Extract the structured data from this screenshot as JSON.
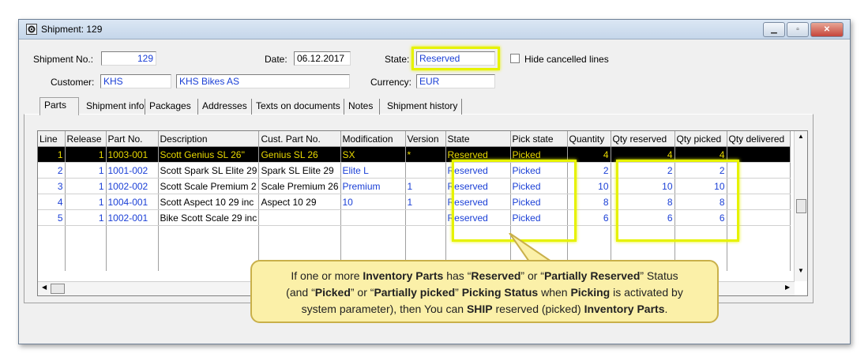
{
  "window": {
    "title": "Shipment: 129"
  },
  "header": {
    "shipment_no_label": "Shipment No.:",
    "shipment_no": "129",
    "date_label": "Date:",
    "date": "06.12.2017",
    "state_label": "State:",
    "state": "Reserved",
    "hide_cancelled_label": "Hide cancelled lines",
    "customer_label": "Customer:",
    "customer_code": "KHS",
    "customer_name": "KHS Bikes AS",
    "currency_label": "Currency:",
    "currency": "EUR"
  },
  "tabs": [
    "Parts",
    "Shipment info",
    "Packages",
    "Addresses",
    "Texts on documents",
    "Notes",
    "Shipment history"
  ],
  "table": {
    "columns": [
      "Line",
      "Release",
      "Part No.",
      "Description",
      "Cust. Part No.",
      "Modification",
      "Version",
      "State",
      "Pick state",
      "Quantity",
      "Qty reserved",
      "Qty picked",
      "Qty delivered"
    ],
    "rows": [
      [
        "1",
        "1",
        "1003-001",
        "Scott Genius SL 26''",
        "Genius SL 26",
        "SX",
        "*",
        "Reserved",
        "Picked",
        "4",
        "4",
        "4",
        ""
      ],
      [
        "2",
        "1",
        "1001-002",
        "Scott Spark SL Elite 29",
        "Spark SL Elite 29",
        "Elite L",
        "",
        "Reserved",
        "Picked",
        "2",
        "2",
        "2",
        ""
      ],
      [
        "3",
        "1",
        "1002-002",
        "Scott Scale Premium 2",
        "Scale Premium 26",
        "Premium",
        "1",
        "Reserved",
        "Picked",
        "10",
        "10",
        "10",
        ""
      ],
      [
        "4",
        "1",
        "1004-001",
        "Scott Aspect 10 29 inc",
        "Aspect 10 29",
        "10",
        "1",
        "Reserved",
        "Picked",
        "8",
        "8",
        "8",
        ""
      ],
      [
        "5",
        "1",
        "1002-001",
        "Bike Scott Scale 29 inc",
        "",
        "",
        "",
        "Reserved",
        "Picked",
        "6",
        "6",
        "6",
        ""
      ]
    ]
  },
  "callout": {
    "line1_a": "If one or more ",
    "line1_b": "Inventory Parts",
    "line1_c": " has “",
    "line1_d": "Reserved",
    "line1_e": "” or “",
    "line1_f": "Partially Reserved",
    "line1_g": "” Status",
    "line2_a": "(and “",
    "line2_b": "Picked",
    "line2_c": "” or “",
    "line2_d": "Partially picked",
    "line2_e": "” ",
    "line2_f": "Picking Status",
    "line2_g": " when ",
    "line2_h": "Picking",
    "line2_i": " is activated by",
    "line3_a": "system parameter), then You can ",
    "line3_b": "SHIP",
    "line3_c": " reserved (picked) ",
    "line3_d": "Inventory Parts",
    "line3_e": "."
  },
  "colors": {
    "highlight": "#e6f200",
    "selection": "#000000",
    "value_blue": "#1a3fd6",
    "callout_bg": "#fbf0a8"
  }
}
